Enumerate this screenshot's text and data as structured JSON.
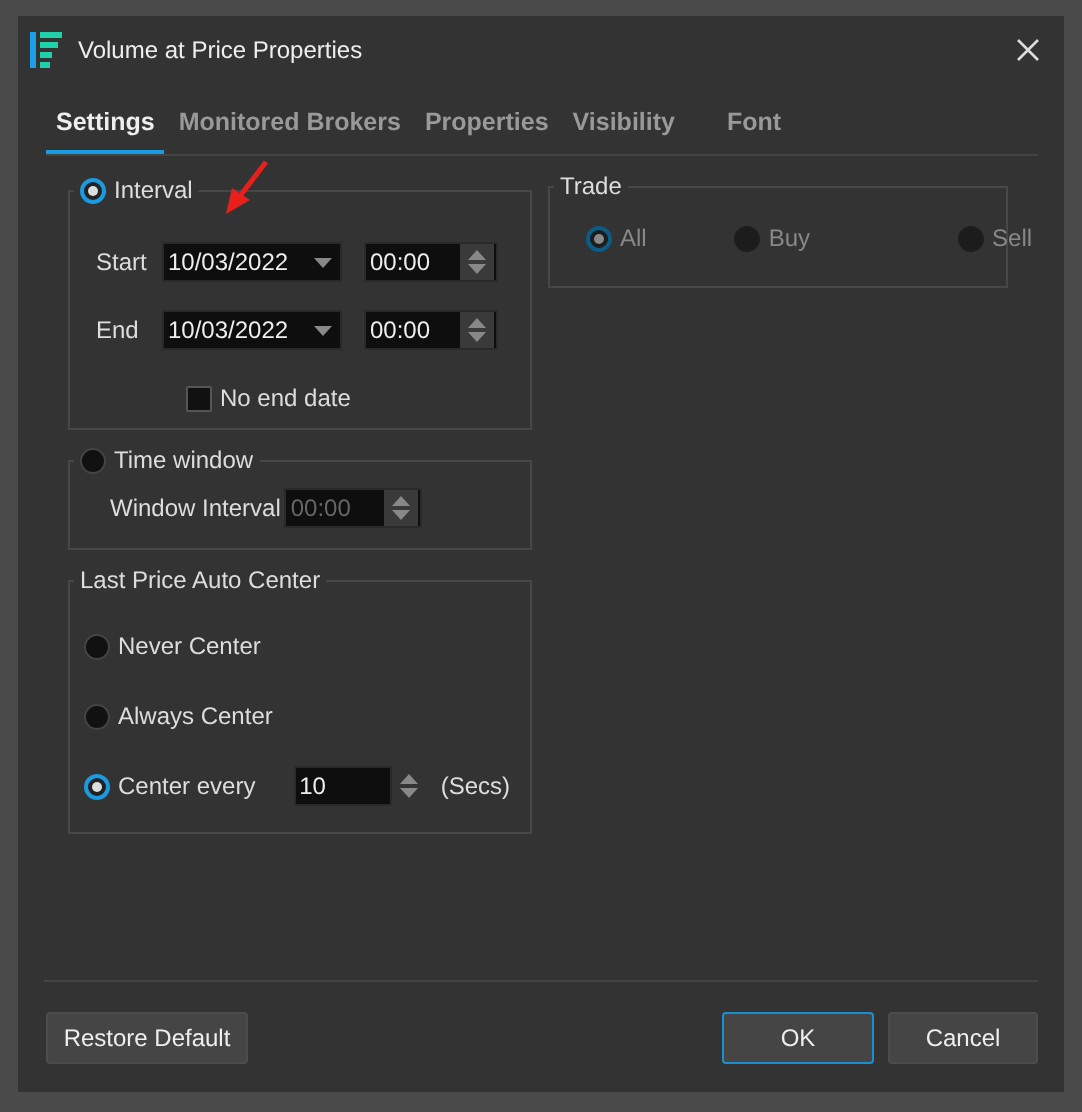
{
  "window": {
    "title": "Volume at Price Properties"
  },
  "tabs": [
    {
      "label": "Settings",
      "selected": true
    },
    {
      "label": "Monitored Brokers",
      "selected": false
    },
    {
      "label": "Properties",
      "selected": false
    },
    {
      "label": "Visibility",
      "selected": false
    },
    {
      "label": "Font",
      "selected": false
    }
  ],
  "interval": {
    "label": "Interval",
    "selected": true,
    "rows": [
      {
        "label": "Start",
        "date": "10/03/2022",
        "time": "00:00"
      },
      {
        "label": "End",
        "date": "10/03/2022",
        "time": "00:00"
      }
    ],
    "no_end_date": {
      "label": "No end date",
      "checked": false
    }
  },
  "time_window": {
    "label": "Time window",
    "selected": false,
    "field_label": "Window Interval",
    "value": "00:00",
    "disabled": true
  },
  "auto_center": {
    "title": "Last Price Auto Center",
    "options": [
      {
        "label": "Never Center",
        "selected": false,
        "kind": "plain"
      },
      {
        "label": "Always Center",
        "selected": false,
        "kind": "plain"
      },
      {
        "label": "Center every",
        "selected": true,
        "kind": "seconds",
        "value": "10",
        "unit": "(Secs)"
      }
    ]
  },
  "trade": {
    "title": "Trade",
    "disabled": true,
    "options": [
      {
        "label": "All",
        "selected": true
      },
      {
        "label": "Buy",
        "selected": false
      },
      {
        "label": "Sell",
        "selected": false
      }
    ]
  },
  "buttons": [
    {
      "label": "Restore Default",
      "kind": "left"
    },
    {
      "label": "OK",
      "kind": "default"
    },
    {
      "label": "Cancel",
      "kind": "normal"
    }
  ]
}
